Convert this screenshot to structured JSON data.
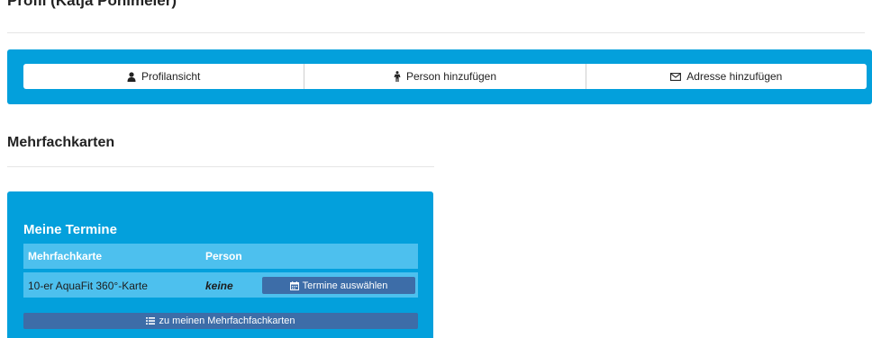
{
  "profile": {
    "heading": "Profil (Katja Pohlmeier)"
  },
  "profile_actions": {
    "items": [
      {
        "label": "Profilansicht",
        "icon": "user-icon"
      },
      {
        "label": "Person hinzufügen",
        "icon": "person-icon"
      },
      {
        "label": "Adresse hinzufügen",
        "icon": "envelope-icon"
      }
    ]
  },
  "section": {
    "title": "Mehrfachkarten"
  },
  "termine_card": {
    "title": "Meine Termine",
    "columns": [
      "Mehrfachkarte",
      "Person"
    ],
    "rows": [
      {
        "mehrfachkarte": "10-er AquaFit 360°-Karte",
        "person": "keine",
        "action_label": "Termine auswählen"
      }
    ],
    "footer_button": "zu meinen Mehrfachfachkarten"
  },
  "colors": {
    "primary": "#03a0dc",
    "table_bg": "#4dc0ee",
    "button_dark": "#3d6da8"
  }
}
